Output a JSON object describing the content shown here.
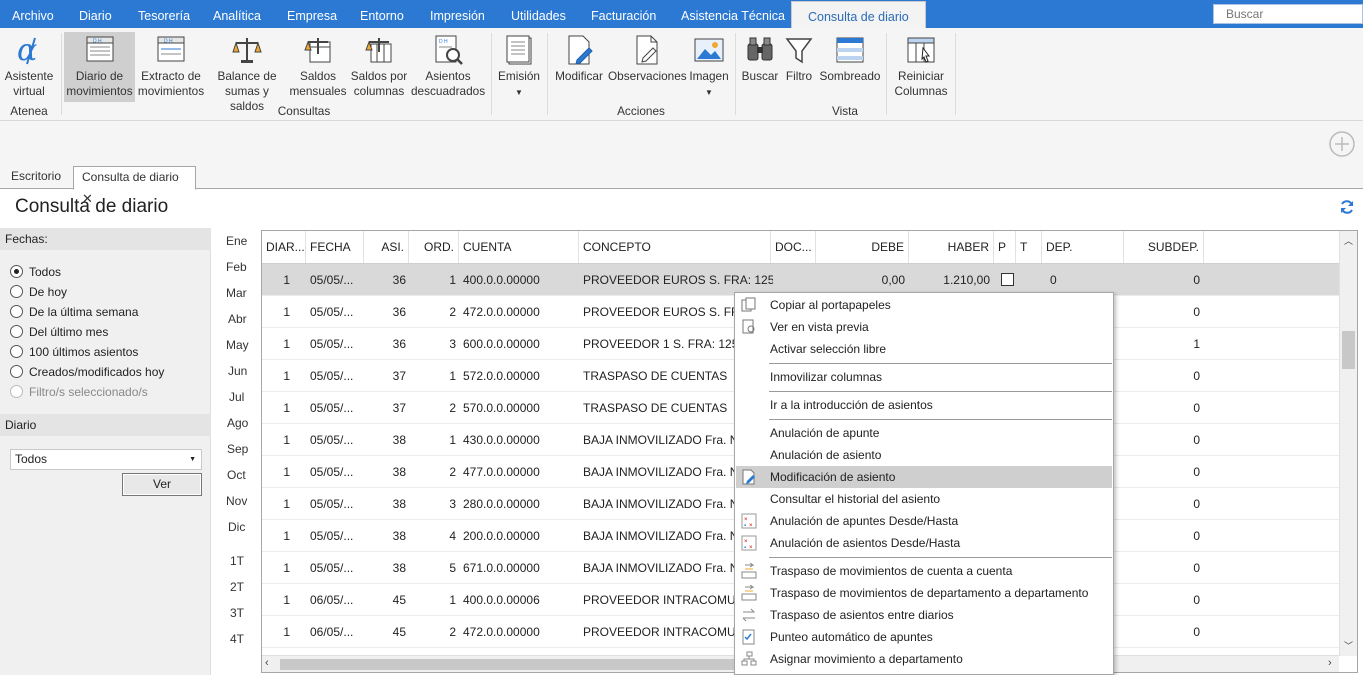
{
  "menu": {
    "items": [
      "Archivo",
      "Diario",
      "Tesorería",
      "Analítica",
      "Empresa",
      "Entorno",
      "Impresión",
      "Utilidades",
      "Facturación",
      "Asistencia Técnica"
    ],
    "active": "Consulta de diario",
    "search_placeholder": "Buscar"
  },
  "ribbon": {
    "atenea": {
      "label": "Atenea",
      "buttons": [
        {
          "l1": "Asistente",
          "l2": "virtual"
        }
      ]
    },
    "consultas": {
      "label": "Consultas",
      "buttons": [
        {
          "l1": "Diario de",
          "l2": "movimientos"
        },
        {
          "l1": "Extracto de",
          "l2": "movimientos"
        },
        {
          "l1": "Balance de",
          "l2": "sumas y saldos"
        },
        {
          "l1": "Saldos",
          "l2": "mensuales"
        },
        {
          "l1": "Saldos por",
          "l2": "columnas"
        },
        {
          "l1": "Asientos",
          "l2": "descuadrados"
        },
        {
          "l1": "Emisión",
          "l2": ""
        }
      ]
    },
    "acciones": {
      "label": "Acciones",
      "buttons": [
        {
          "l1": "Modificar"
        },
        {
          "l1": "Observaciones"
        },
        {
          "l1": "Imagen"
        }
      ]
    },
    "vista": {
      "label": "Vista",
      "buttons": [
        {
          "l1": "Buscar"
        },
        {
          "l1": "Filtro"
        },
        {
          "l1": "Sombreado"
        },
        {
          "l1": "Reiniciar",
          "l2": "Columnas"
        }
      ]
    }
  },
  "tabs": [
    "Escritorio",
    "Consulta de diario"
  ],
  "page_title": "Consulta de diario",
  "filters": {
    "fechas_label": "Fechas:",
    "options": [
      "Todos",
      "De hoy",
      "De la última semana",
      "Del último mes",
      "100 últimos asientos",
      "Creados/modificados hoy",
      "Filtro/s seleccionado/s"
    ],
    "selected": "Todos",
    "diario_label": "Diario",
    "diario_value": "Todos",
    "ver_button": "Ver"
  },
  "months": [
    "Ene",
    "Feb",
    "Mar",
    "Abr",
    "May",
    "Jun",
    "Jul",
    "Ago",
    "Sep",
    "Oct",
    "Nov",
    "Dic",
    "1T",
    "2T",
    "3T",
    "4T"
  ],
  "grid": {
    "headers": [
      "DIAR...",
      "FECHA",
      "ASI.",
      "ORD.",
      "CUENTA",
      "CONCEPTO",
      "DOC...",
      "DEBE",
      "HABER",
      "P",
      "T",
      "DEP.",
      "SUBDEP."
    ],
    "rows": [
      {
        "diario": "1",
        "fecha": "05/05/...",
        "asi": "36",
        "ord": "1",
        "cuenta": "400.0.0.00000",
        "concepto": "PROVEEDOR EUROS S. FRA:  1259",
        "debe": "0,00",
        "haber": "1.210,00",
        "dep": "0",
        "subdep": "0"
      },
      {
        "diario": "1",
        "fecha": "05/05/...",
        "asi": "36",
        "ord": "2",
        "cuenta": "472.0.0.00000",
        "concepto": "PROVEEDOR EUROS S. FRA:",
        "subdep": "0"
      },
      {
        "diario": "1",
        "fecha": "05/05/...",
        "asi": "36",
        "ord": "3",
        "cuenta": "600.0.0.00000",
        "concepto": "PROVEEDOR 1 S. FRA:  1259/5",
        "subdep": "1"
      },
      {
        "diario": "1",
        "fecha": "05/05/...",
        "asi": "37",
        "ord": "1",
        "cuenta": "572.0.0.00000",
        "concepto": "TRASPASO DE CUENTAS",
        "subdep": "0"
      },
      {
        "diario": "1",
        "fecha": "05/05/...",
        "asi": "37",
        "ord": "2",
        "cuenta": "570.0.0.00000",
        "concepto": "TRASPASO DE CUENTAS",
        "subdep": "0"
      },
      {
        "diario": "1",
        "fecha": "05/05/...",
        "asi": "38",
        "ord": "1",
        "cuenta": "430.0.0.00000",
        "concepto": "BAJA INMOVILIZADO Fra. Nº",
        "subdep": "0"
      },
      {
        "diario": "1",
        "fecha": "05/05/...",
        "asi": "38",
        "ord": "2",
        "cuenta": "477.0.0.00000",
        "concepto": "BAJA INMOVILIZADO Fra. Nº",
        "subdep": "0"
      },
      {
        "diario": "1",
        "fecha": "05/05/...",
        "asi": "38",
        "ord": "3",
        "cuenta": "280.0.0.00000",
        "concepto": "BAJA INMOVILIZADO Fra. Nº",
        "subdep": "0"
      },
      {
        "diario": "1",
        "fecha": "05/05/...",
        "asi": "38",
        "ord": "4",
        "cuenta": "200.0.0.00000",
        "concepto": "BAJA INMOVILIZADO Fra. Nº",
        "subdep": "0"
      },
      {
        "diario": "1",
        "fecha": "05/05/...",
        "asi": "38",
        "ord": "5",
        "cuenta": "671.0.0.00000",
        "concepto": "BAJA INMOVILIZADO Fra. Nº",
        "subdep": "0"
      },
      {
        "diario": "1",
        "fecha": "06/05/...",
        "asi": "45",
        "ord": "1",
        "cuenta": "400.0.0.00006",
        "concepto": "PROVEEDOR INTRACOMUN",
        "subdep": "0"
      },
      {
        "diario": "1",
        "fecha": "06/05/...",
        "asi": "45",
        "ord": "2",
        "cuenta": "472.0.0.00000",
        "concepto": "PROVEEDOR INTRACOMUN",
        "subdep": "0"
      }
    ]
  },
  "context_menu": {
    "groups": [
      [
        "Copiar al portapapeles",
        "Ver en vista previa",
        "Activar selección libre"
      ],
      [
        "Inmovilizar columnas"
      ],
      [
        "Ir a la introducción de asientos"
      ],
      [
        "Anulación de apunte",
        "Anulación de asiento",
        "Modificación de asiento",
        "Consultar el historial del asiento",
        "Anulación de apuntes Desde/Hasta",
        "Anulación de asientos Desde/Hasta"
      ],
      [
        "Traspaso de movimientos de cuenta a cuenta",
        "Traspaso de movimientos de departamento a departamento",
        "Traspaso de asientos entre diarios",
        "Punteo automático de apuntes",
        "Asignar movimiento a departamento"
      ]
    ],
    "highlighted": "Modificación de asiento"
  },
  "colors": {
    "accent": "#2b79d3",
    "ribbon_bg": "#f5f5f5",
    "highlight": "#cfcfcf"
  }
}
